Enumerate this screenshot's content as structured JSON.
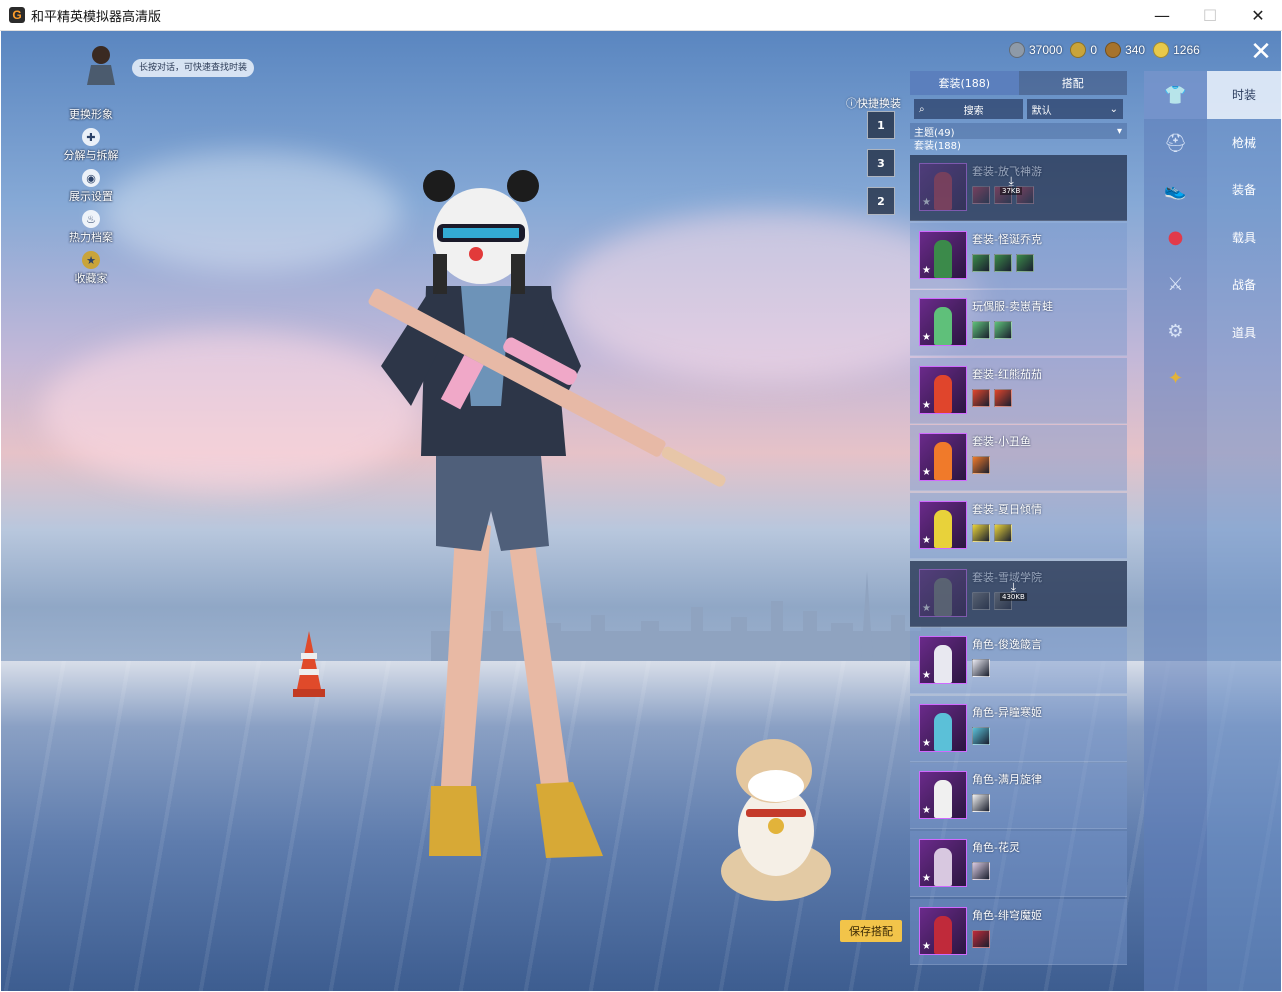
{
  "window": {
    "title": "和平精英模拟器高清版",
    "app_icon": "app-logo-icon",
    "controls": {
      "minimize": "—",
      "maximize": "☐",
      "close": "✕"
    }
  },
  "left_menu": {
    "tip": "长按对话，可快速查找时装",
    "items": [
      {
        "label": "更换形象",
        "icon": "avatar-icon"
      },
      {
        "label": "分解与拆解",
        "icon": "puzzle-icon"
      },
      {
        "label": "展示设置",
        "icon": "eye-icon"
      },
      {
        "label": "热力档案",
        "icon": "flame-icon"
      },
      {
        "label": "收藏家",
        "icon": "collector-badge-icon"
      }
    ]
  },
  "currencies": [
    {
      "value": "37000",
      "icon": "coin-silver-icon",
      "color": "#8e9aa8"
    },
    {
      "value": "0",
      "icon": "coin-gold-icon",
      "color": "#c9a43a"
    },
    {
      "value": "340",
      "icon": "coin-bronze-icon",
      "color": "#a6732c"
    },
    {
      "value": "1266",
      "icon": "coin-star-icon",
      "color": "#e8c94a"
    }
  ],
  "quick_change": {
    "label": "快捷换装",
    "slots": [
      "1",
      "3",
      "2"
    ]
  },
  "panel": {
    "tabs": [
      "套装(188)",
      "搭配"
    ],
    "search_placeholder": "搜索",
    "sort": "默认",
    "theme": "主题(49)",
    "set_header": "套装(188)",
    "items": [
      {
        "name": "套装-放飞神游",
        "minis": 3,
        "state": "downloading",
        "size": "37KB",
        "fig": "#c0324a"
      },
      {
        "name": "套装-怪诞乔克",
        "minis": 3,
        "state": "normal",
        "fig": "#3b8a4a"
      },
      {
        "name": "玩偶服-卖崽青蛙",
        "minis": 2,
        "state": "normal",
        "fig": "#5fc07a"
      },
      {
        "name": "套装-红熊茄茄",
        "minis": 2,
        "state": "normal",
        "fig": "#e0452c"
      },
      {
        "name": "套装-小丑鱼",
        "minis": 1,
        "state": "normal",
        "fig": "#f07a2a"
      },
      {
        "name": "套装-夏日倾情",
        "minis": 2,
        "state": "normal",
        "fig": "#e8d23a"
      },
      {
        "name": "套装-雪域学院",
        "minis": 2,
        "state": "downloading",
        "size": "430KB",
        "fig": "#7a7a7a"
      },
      {
        "name": "角色-俊逸箴言",
        "minis": 1,
        "state": "normal",
        "fig": "#e8e8f0"
      },
      {
        "name": "角色-异瞳寒姬",
        "minis": 1,
        "state": "normal",
        "fig": "#5bc0d8"
      },
      {
        "name": "角色-满月旋律",
        "minis": 1,
        "state": "normal",
        "fig": "#f0f0f0"
      },
      {
        "name": "角色-花灵",
        "minis": 1,
        "state": "normal",
        "fig": "#d8c8e0"
      },
      {
        "name": "角色-绯穹魔姬",
        "minis": 1,
        "state": "normal",
        "fig": "#c02a3a"
      }
    ]
  },
  "categories": [
    {
      "label": "时装",
      "icon": "outfit-icon",
      "active": true
    },
    {
      "label": "枪械",
      "icon": "helmet-icon",
      "active": false
    },
    {
      "label": "装备",
      "icon": "shoe-icon",
      "active": false
    },
    {
      "label": "载具",
      "icon": "ball-icon",
      "active": false
    },
    {
      "label": "战备",
      "icon": "gun-icon",
      "active": false
    },
    {
      "label": "道具",
      "icon": "vehicle-icon",
      "active": false
    },
    {
      "label": "",
      "icon": "wing-icon",
      "active": false
    }
  ],
  "save_button": "保存搭配"
}
